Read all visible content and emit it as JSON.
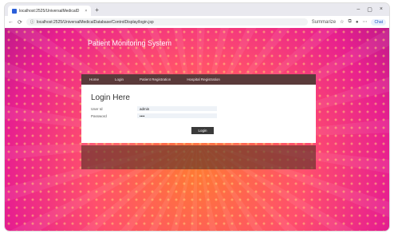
{
  "browser": {
    "tab_title": "localhost:2525/UniversalMedicalD",
    "tab_close": "×",
    "new_tab": "+",
    "url": "localhost:2525/UniversalMedicalDatabase/ControlDisplay/login.jsp",
    "translate_label": "Summarize",
    "chat_label": "Chat",
    "window_controls": [
      "–",
      "▢",
      "×"
    ]
  },
  "site": {
    "title": "Patient Monitoring System",
    "nav": [
      "Home",
      "Login",
      "Patient Registration",
      "Hospital Registration"
    ]
  },
  "login": {
    "heading": "Login Here",
    "user_label": "User Id",
    "user_value": "admin",
    "password_label": "Password",
    "password_value": "••••",
    "button": "Login"
  },
  "colors": {
    "bg_top": "#e8208e",
    "bg_center": "#ff7a33",
    "menu_bar": "#5a3a3a",
    "button": "#3a3a3a"
  }
}
